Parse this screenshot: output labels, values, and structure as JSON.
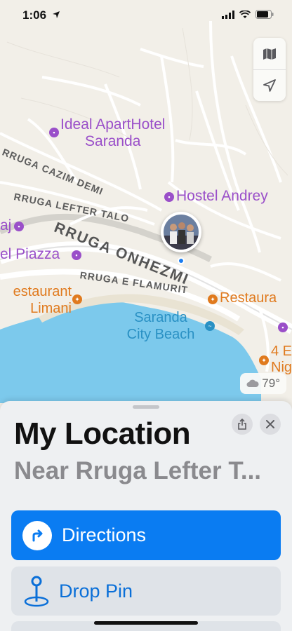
{
  "status_bar": {
    "time": "1:06"
  },
  "map": {
    "pois": {
      "ideal_aparthotel": "Ideal ApartHotel\nSaranda",
      "ideal_line1": "Ideal ApartHotel",
      "ideal_line2": "Saranda",
      "hostel_andrey": "Hostel Andrey",
      "aj": "aj",
      "el_piazza": "el Piazza",
      "restaurant_limani_line1": "estaurant",
      "restaurant_limani_line2": "Limani",
      "saranda_city_beach_line1": "Saranda",
      "saranda_city_beach_line2": "City Beach",
      "restaura": "Restaura",
      "four_line1": "4 E",
      "four_line2": "Nig"
    },
    "streets": {
      "cazim_demi": "RRUGA CAZIM DEMI",
      "lefter_talo": "RRUGA LEFTER TALO",
      "onhezmi": "RRUGA ONHEZMI",
      "e_flamurit": "RRUGA E FLAMURIT"
    },
    "weather": "79°"
  },
  "sheet": {
    "title": "My Location",
    "subtitle": "Near Rruga Lefter T...",
    "directions_label": "Directions",
    "drop_pin_label": "Drop Pin"
  },
  "colors": {
    "accent": "#0a7cf2",
    "poi_purple": "#9a4fc9",
    "poi_orange": "#e07a1e",
    "poi_blue": "#2a91c4",
    "water": "#7cc9ec"
  }
}
